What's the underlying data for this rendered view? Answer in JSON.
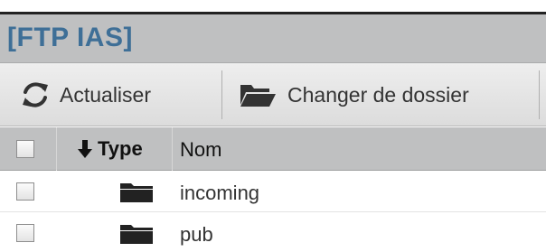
{
  "window": {
    "title": "[FTP IAS]"
  },
  "toolbar": {
    "refresh_label": "Actualiser",
    "change_folder_label": "Changer de dossier"
  },
  "table": {
    "columns": {
      "type": "Type",
      "name": "Nom"
    },
    "rows": [
      {
        "name": "incoming",
        "icon": "folder-icon"
      },
      {
        "name": "pub",
        "icon": "folder-icon"
      }
    ]
  },
  "colors": {
    "title_text": "#3e6f97",
    "title_bar_bg": "#bfc0c1",
    "header_bg": "#bfc0c1",
    "toolbar_bg": "#e6e6e6"
  }
}
